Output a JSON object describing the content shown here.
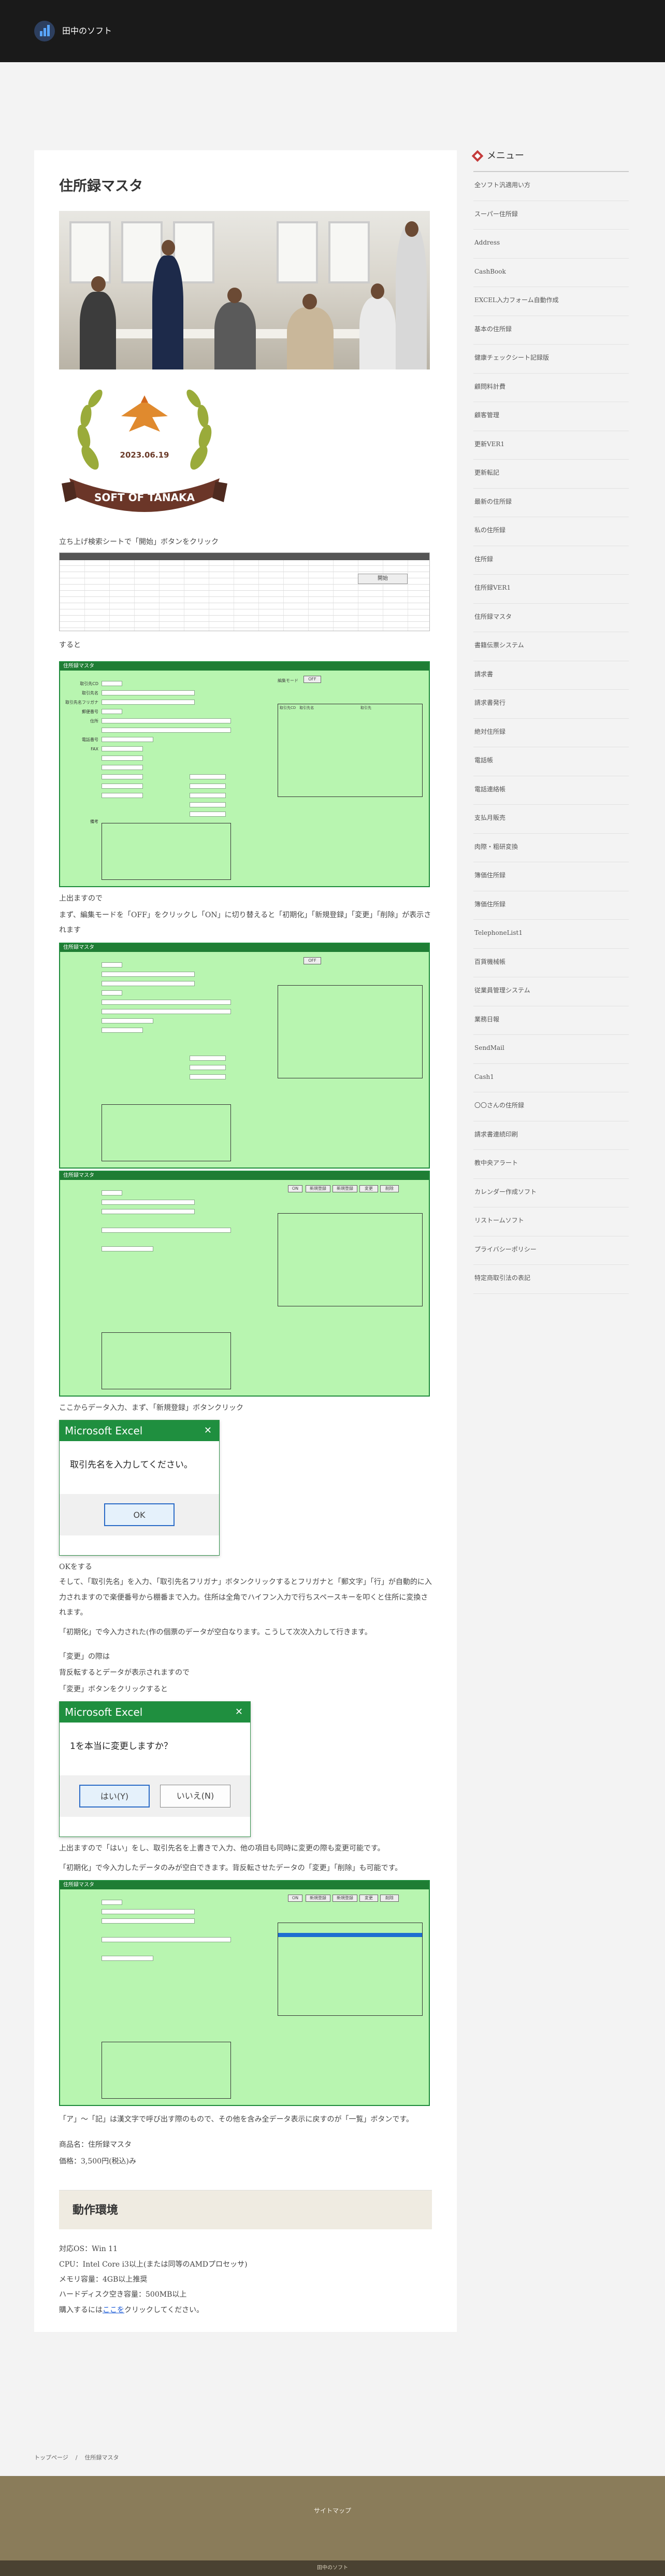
{
  "header": {
    "site_name": "田中のソフト"
  },
  "main": {
    "title": "住所録マスタ",
    "emblem": {
      "date": "2023.06.19",
      "ribbon_text": "SOFT OF TANAKA"
    },
    "intro_line": "立ち上げ検索シートで「開始」ボタンをクリック",
    "sheet_button": "開始",
    "after_sheet": "すると",
    "form_title": "住所録マスタ",
    "form_labels": [
      "取引先CD",
      "取引先名",
      "取引先名フリガナ",
      "郵便番号",
      "住所",
      "",
      "",
      "",
      "電話番号",
      "FAX",
      "",
      "",
      "",
      "",
      "",
      "",
      "",
      "備考"
    ],
    "edit_mode_label": "編集モード",
    "edit_mode_off": "OFF",
    "edit_mode_on": "ON",
    "form_buttons": [
      "新規登録",
      "新規登録",
      "変更",
      "削除"
    ],
    "list_header_1": "取引先CD　取引先名",
    "list_header_2": "取引先",
    "step1": "上出ますので",
    "step2": "まず、編集モードを「OFF」をクリックし「ON」に切り替えると「初期化」「新規登録」「変更」「削除」が表示されます",
    "step3": "ここからデータ入力、まず、「新規登録」ボタンクリック",
    "dialog1": {
      "title": "Microsoft Excel",
      "message": "取引先名を入力してください。",
      "ok": "OK"
    },
    "ok_caption": "OKをする",
    "para1": "そして、「取引先名」を入力、「取引先名フリガナ」ボタンクリックするとフリガナと「郵文字」「行」が自動的に入力されますので楽便番号から棚番まで入力。住所は全角でハイフン入力で行ちスペースキーを叩くと住所に変換されます。",
    "para2": "「初期化」で今入力された(作の個票のデータが空白なります。こうして次次入力して行きます。",
    "change_1": "「変更」の際は",
    "change_2": "背反転するとデータが表示されますので",
    "change_3": "「変更」ボタンをクリックすると",
    "dialog2": {
      "title": "Microsoft Excel",
      "message": "1を本当に変更しますか？",
      "yes": "はい(Y)",
      "no": "いいえ(N)"
    },
    "para3": "上出ますので「はい」をし、取引先名を上書きで入力、他の項目も同時に変更の際も変更可能です。",
    "para4": "「初期化」で今入力したデータのみが空白できます。背反転させたデータの「変更」「削除」も可能です。",
    "para5": "「ア」～「記」は漢文字で呼び出す際のもので、その他を含み全データ表示に戻すのが「一覧」ボタンです。",
    "product_name": "商品名：住所録マスタ",
    "price": "価格：3,500円(税込)み",
    "env_title": "動作環境",
    "env_lines": [
      "対応OS：Win 11",
      "CPU：Intel Core i3以上(または同等のAMDプロセッサ)",
      "メモリ容量：4GB以上推奨",
      "ハードディスク空き容量：500MB以上"
    ],
    "purchase_prefix": "購入するには",
    "purchase_link": "ここを",
    "purchase_suffix": "クリックしてください。"
  },
  "sidebar": {
    "title": "メニュー",
    "items": [
      "全ソフト汎適用い方",
      "スーパー住所録",
      "Address",
      "CashBook",
      "EXCEL入力フォーム自動作成",
      "基本の住所録",
      "健康チェックシート記録版",
      "顧問料計費",
      "顧客管理",
      "更新VER1",
      "更新転記",
      "最新の住所録",
      "私の住所録",
      "住所録",
      "住所録VER1",
      "住所録マスタ",
      "書籍伝票システム",
      "請求書",
      "請求書発行",
      "絶対住所録",
      "電話帳",
      "電話連絡帳",
      "支払月販売",
      "肉際・粗研変換",
      "簿価住所録",
      "簿価住所録",
      "TelephoneList1",
      "百貨機械帳",
      "従業員管理システム",
      "業務日報",
      "SendMail",
      "Cash1",
      "〇〇さんの住所録",
      "請求書連続印刷",
      "教中央アラート",
      "カレンダー作成ソフト",
      "リストームソフト",
      "プライバシーポリシー",
      "特定商取引法の表記"
    ]
  },
  "breadcrumb": {
    "home": "トップページ",
    "sep": "/",
    "current": "住所録マスタ"
  },
  "footer": {
    "link": "サイトマップ",
    "copyright": "田中のソフト"
  }
}
